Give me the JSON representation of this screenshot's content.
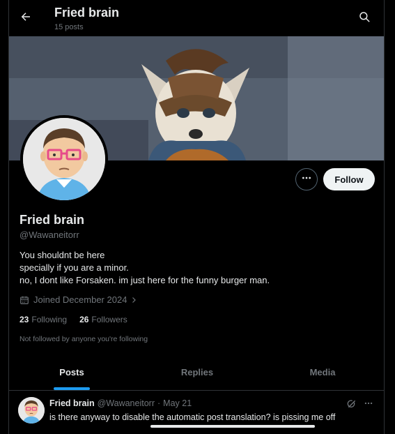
{
  "header": {
    "title": "Fried brain",
    "post_count": "15 posts",
    "back_icon": "arrow-left-icon",
    "search_icon": "search-icon"
  },
  "profile": {
    "name": "Fried brain",
    "handle": "@Wawaneitorr",
    "bio_lines": [
      "You shouldnt be here",
      "specially if you are a minor.",
      "no, I dont like Forsaken. im just here for the funny burger man."
    ],
    "joined": "Joined December 2024",
    "following_count": "23",
    "following_label": "Following",
    "followers_count": "26",
    "followers_label": "Followers",
    "not_followed_text": "Not followed by anyone you're following"
  },
  "actions": {
    "more_icon": "more-horizontal-icon",
    "follow_label": "Follow"
  },
  "tabs": [
    {
      "label": "Posts",
      "active": true
    },
    {
      "label": "Replies",
      "active": false
    },
    {
      "label": "Media",
      "active": false
    }
  ],
  "post": {
    "author": "Fried brain",
    "handle": "@Wawaneitorr",
    "separator": "·",
    "date": "May 21",
    "text": "is there anyway to disable the automatic post translation? is pissing me off"
  },
  "colors": {
    "background": "#000000",
    "accent": "#1d9bf0",
    "text_primary": "#e7e9ea",
    "text_secondary": "#71767b",
    "follow_button_bg": "#eff3f4"
  }
}
